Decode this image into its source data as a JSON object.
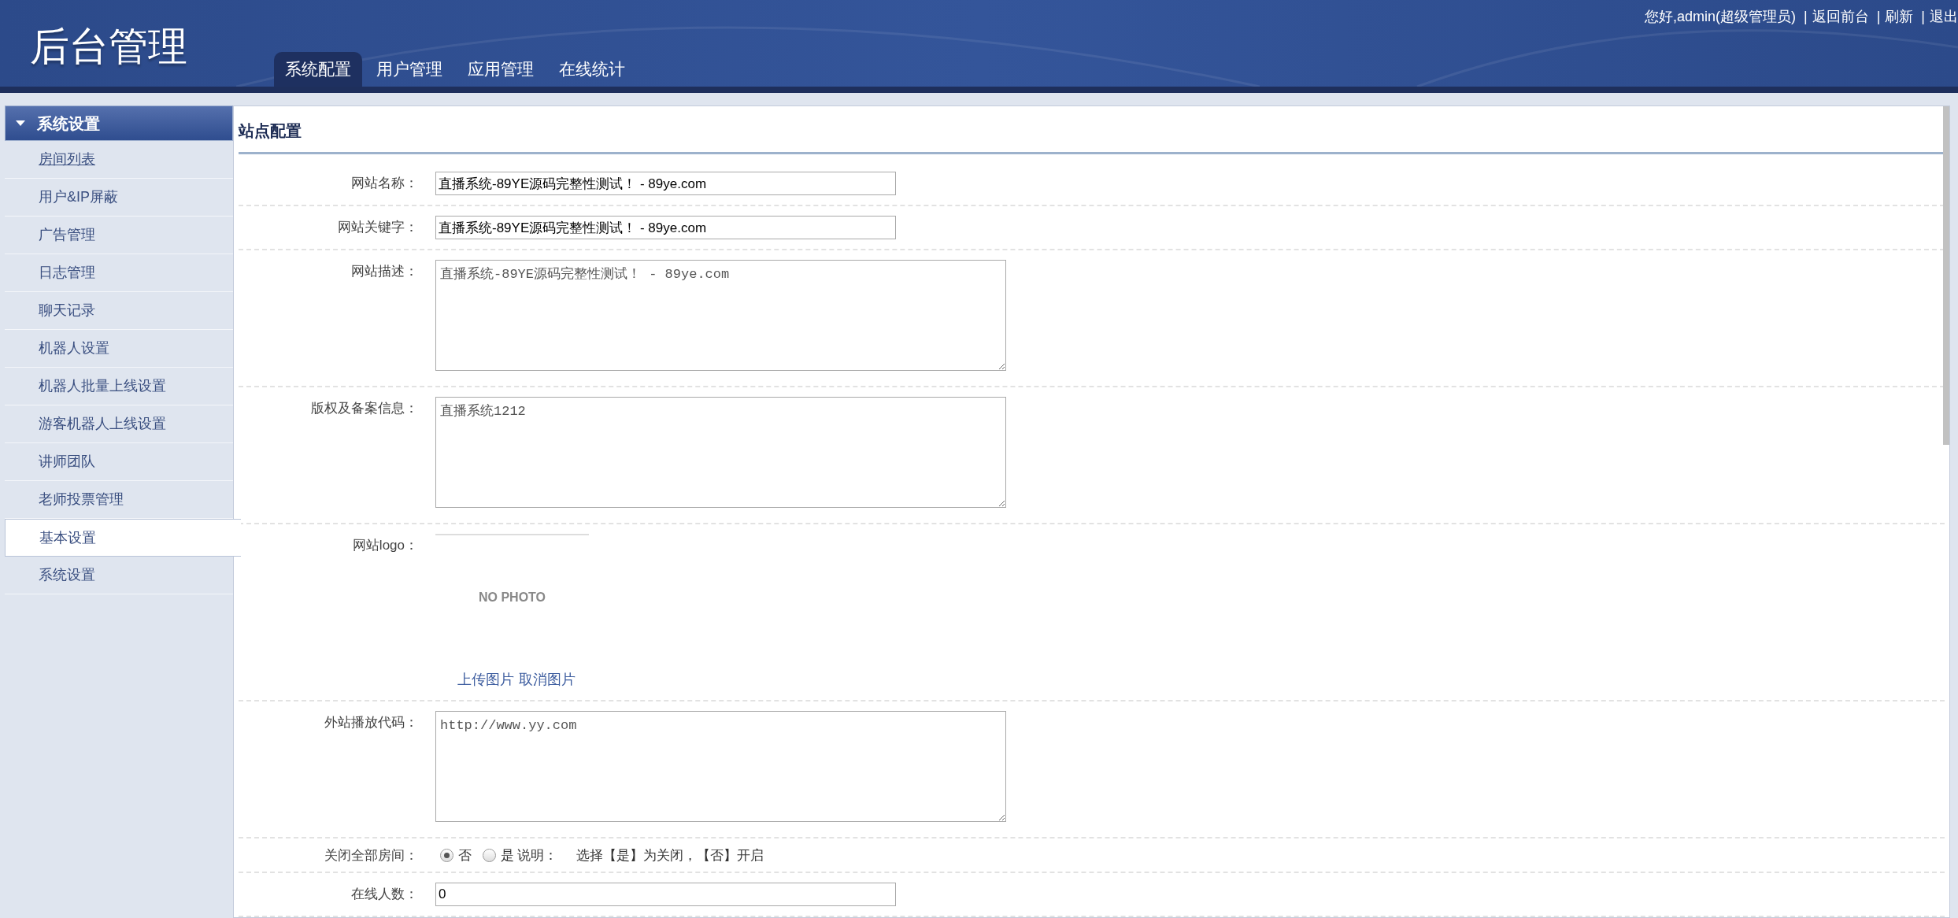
{
  "header": {
    "title": "后台管理",
    "greeting": "您好,admin(超级管理员)",
    "separator": "|",
    "links": [
      "返回前台",
      "刷新",
      "退出"
    ]
  },
  "tabs": [
    {
      "label": "系统配置",
      "selected": true
    },
    {
      "label": "用户管理",
      "selected": false
    },
    {
      "label": "应用管理",
      "selected": false
    },
    {
      "label": "在线统计",
      "selected": false
    }
  ],
  "sidebar": {
    "section": {
      "title": "系统设置",
      "expanded": true
    },
    "items": [
      {
        "label": "房间列表",
        "selected": false,
        "hovered": true
      },
      {
        "label": "用户&IP屏蔽",
        "selected": false,
        "hovered": false
      },
      {
        "label": "广告管理",
        "selected": false,
        "hovered": false
      },
      {
        "label": "日志管理",
        "selected": false,
        "hovered": false
      },
      {
        "label": "聊天记录",
        "selected": false,
        "hovered": false
      },
      {
        "label": "机器人设置",
        "selected": false,
        "hovered": false
      },
      {
        "label": "机器人批量上线设置",
        "selected": false,
        "hovered": false
      },
      {
        "label": "游客机器人上线设置",
        "selected": false,
        "hovered": false
      },
      {
        "label": "讲师团队",
        "selected": false,
        "hovered": false
      },
      {
        "label": "老师投票管理",
        "selected": false,
        "hovered": false
      },
      {
        "label": "基本设置",
        "selected": true,
        "hovered": false
      },
      {
        "label": "系统设置",
        "selected": false,
        "hovered": false
      }
    ]
  },
  "panel": {
    "title": "站点配置",
    "fields": [
      {
        "kind": "input",
        "label": "网站名称：",
        "value": "直播系统-89YE源码完整性测试！ - 89ye.com"
      },
      {
        "kind": "input",
        "label": "网站关键字：",
        "value": "直播系统-89YE源码完整性测试！ - 89ye.com"
      },
      {
        "kind": "textarea",
        "label": "网站描述：",
        "value": "直播系统-89YE源码完整性测试！ - 89ye.com"
      },
      {
        "kind": "textarea",
        "label": "版权及备案信息：",
        "value": "直播系统1212"
      },
      {
        "kind": "image",
        "label": "网站logo：",
        "image_text": "NO PHOTO",
        "links": [
          "上传图片",
          "取消图片"
        ]
      },
      {
        "kind": "textarea",
        "label": "外站播放代码：",
        "value": "http://www.yy.com"
      },
      {
        "kind": "radio",
        "label": "关闭全部房间：",
        "options": [
          {
            "label": "否",
            "selected": true
          },
          {
            "label": "是",
            "selected": false
          }
        ],
        "note_label": "说明：",
        "note": "选择【是】为关闭，【否】开启"
      },
      {
        "kind": "input",
        "label": "在线人数：",
        "value": "0"
      }
    ]
  }
}
